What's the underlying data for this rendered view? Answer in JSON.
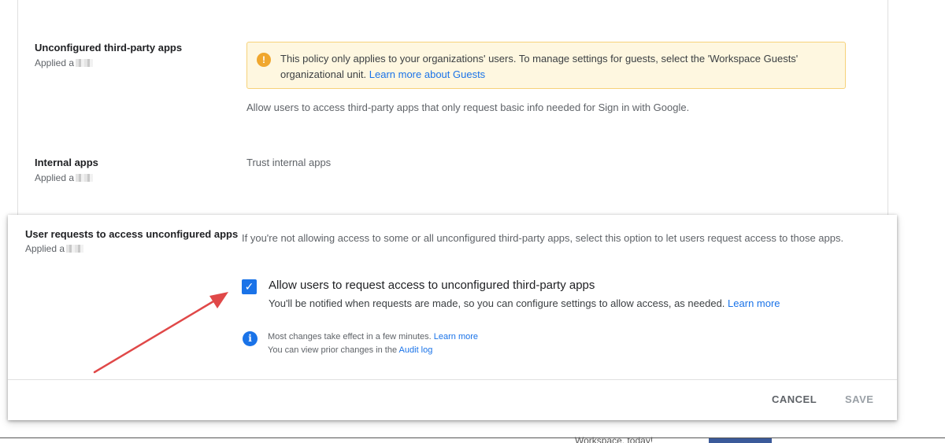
{
  "settings": {
    "rows": [
      {
        "title": "Unconfigured third-party apps",
        "applied_prefix": "Applied a"
      },
      {
        "title": "Internal apps",
        "applied_prefix": "Applied a"
      }
    ],
    "warning": {
      "icon": "warning-icon",
      "text": "This policy only applies to your organizations' users. To manage settings for guests, select the 'Workspace Guests' organizational unit.",
      "link": "Learn more about Guests"
    },
    "unconfigured_desc": "Allow users to access third-party apps that only request basic info needed for Sign in with Google.",
    "internal_desc": "Trust internal apps"
  },
  "modal": {
    "title": "User requests to access unconfigured apps",
    "applied_prefix": "Applied a",
    "description": "If you're not allowing access to some or all unconfigured third-party apps, select this option to let users request access to those apps.",
    "checkbox": {
      "checked": true,
      "label": "Allow users to request access to unconfigured third-party apps",
      "help": "You'll be notified when requests are made, so you can configure settings to allow access, as needed.",
      "help_link": "Learn more"
    },
    "info": {
      "line1": "Most changes take effect in a few minutes.",
      "line1_link": "Learn more",
      "line2": "You can view prior changes in the",
      "line2_link": "Audit log"
    },
    "buttons": {
      "cancel": "CANCEL",
      "save": "SAVE"
    }
  },
  "background": {
    "bottom_text": "Workspace, today!"
  },
  "colors": {
    "accent": "#1a73e8",
    "warning": "#f0a72e",
    "arrow": "#e04848"
  }
}
